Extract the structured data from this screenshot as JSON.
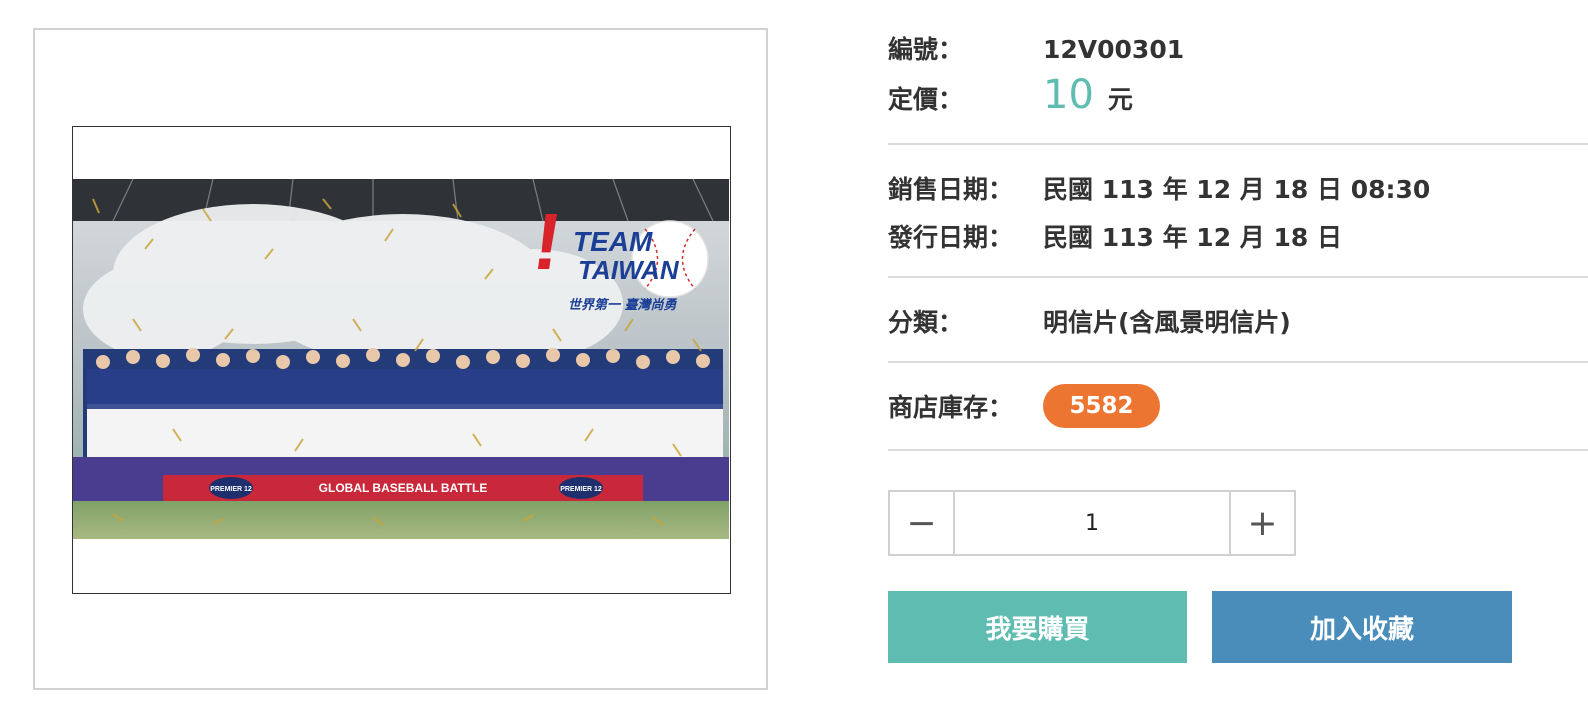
{
  "product": {
    "id_label": "編號：",
    "id_value": "12V00301",
    "price_label": "定價：",
    "price_value": "10",
    "price_unit": "元",
    "sale_date_label": "銷售日期：",
    "sale_date_value": "民國 113 年 12 月 18 日 08:30",
    "issue_date_label": "發行日期：",
    "issue_date_value": "民國 113 年 12 月 18 日",
    "category_label": "分類：",
    "category_value": "明信片(含風景明信片)",
    "stock_label": "商店庫存：",
    "stock_value": "5582"
  },
  "image": {
    "logo_line1": "TEAM",
    "logo_line2": "TAIWAN",
    "logo_tagline": "世界第一 臺灣尚勇",
    "banner_text": "GLOBAL BASEBALL BATTLE",
    "badge_text": "PREMIER 12"
  },
  "quantity": {
    "minus_label": "−",
    "value": "1",
    "plus_label": "+"
  },
  "actions": {
    "buy_label": "我要購買",
    "favorite_label": "加入收藏"
  },
  "colors": {
    "accent_teal": "#5fbcb1",
    "accent_blue": "#4a8dbb",
    "badge_orange": "#ec7532"
  }
}
